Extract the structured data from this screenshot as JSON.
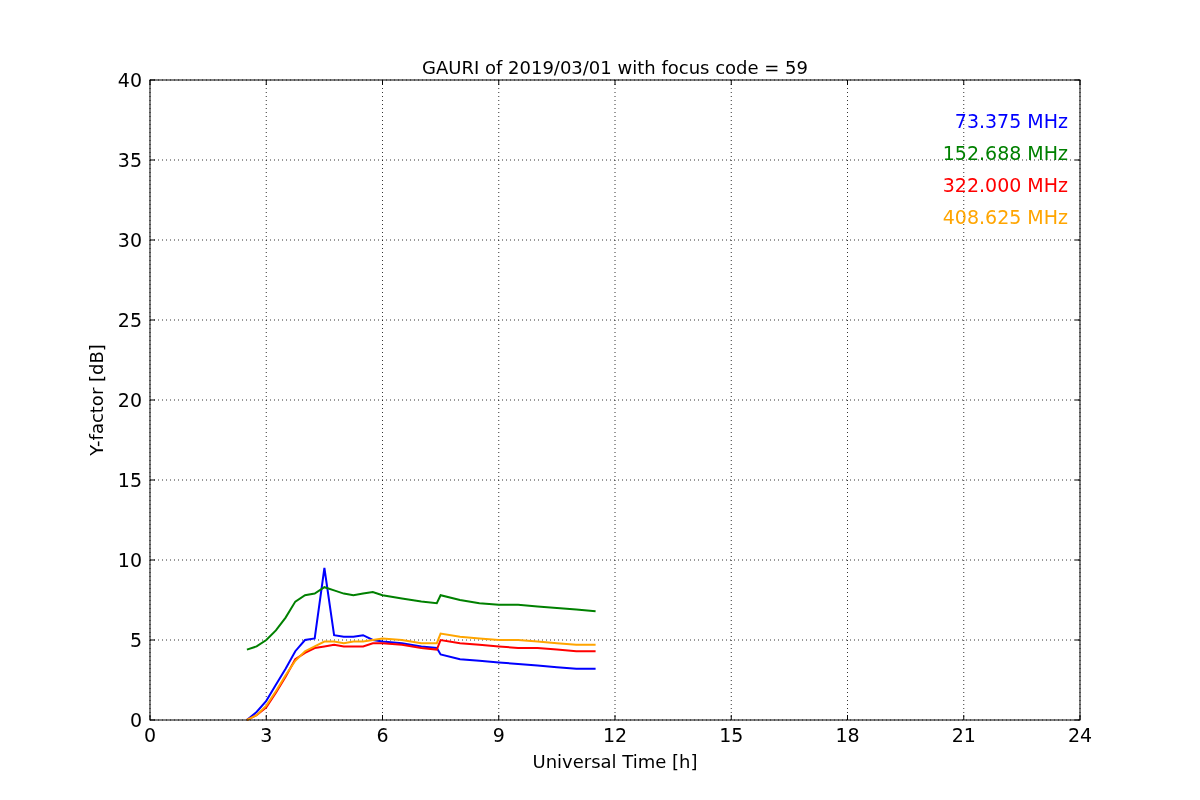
{
  "chart_data": {
    "type": "line",
    "title": "GAURI of 2019/03/01 with focus code = 59",
    "xlabel": "Universal Time [h]",
    "ylabel": "Y-factor [dB]",
    "x": [
      2.5,
      2.75,
      3,
      3.25,
      3.5,
      3.75,
      4,
      4.25,
      4.5,
      4.75,
      5,
      5.25,
      5.5,
      5.75,
      6,
      6.5,
      7,
      7.4,
      7.5,
      8,
      8.5,
      9,
      9.5,
      10,
      10.5,
      11,
      11.5
    ],
    "series": [
      {
        "name": "73.375 MHz",
        "color": "#0000ff",
        "values": [
          0,
          0.5,
          1.2,
          2.2,
          3.2,
          4.3,
          5.0,
          5.1,
          9.5,
          5.3,
          5.2,
          5.2,
          5.3,
          5.0,
          4.9,
          4.8,
          4.6,
          4.5,
          4.1,
          3.8,
          3.7,
          3.6,
          3.5,
          3.4,
          3.3,
          3.2,
          3.2
        ]
      },
      {
        "name": "152.688 MHz",
        "color": "#008000",
        "values": [
          4.4,
          4.6,
          5.0,
          5.6,
          6.4,
          7.4,
          7.8,
          7.9,
          8.3,
          8.1,
          7.9,
          7.8,
          7.9,
          8.0,
          7.8,
          7.6,
          7.4,
          7.3,
          7.8,
          7.5,
          7.3,
          7.2,
          7.2,
          7.1,
          7.0,
          6.9,
          6.8
        ]
      },
      {
        "name": "322.000 MHz",
        "color": "#ff0000",
        "values": [
          0,
          0.3,
          0.8,
          1.7,
          2.7,
          3.8,
          4.2,
          4.5,
          4.6,
          4.7,
          4.6,
          4.6,
          4.6,
          4.8,
          4.8,
          4.7,
          4.5,
          4.4,
          5.0,
          4.8,
          4.7,
          4.6,
          4.5,
          4.5,
          4.4,
          4.3,
          4.3
        ]
      },
      {
        "name": "408.625 MHz",
        "color": "#ffa500",
        "values": [
          0,
          0.3,
          0.9,
          1.8,
          2.8,
          3.7,
          4.3,
          4.6,
          4.9,
          4.9,
          4.8,
          4.9,
          4.9,
          5.0,
          5.1,
          5.0,
          4.8,
          4.8,
          5.4,
          5.2,
          5.1,
          5.0,
          5.0,
          4.9,
          4.8,
          4.7,
          4.7
        ]
      }
    ],
    "grid": true,
    "xlim": [
      0,
      24
    ],
    "ylim": [
      0,
      40
    ],
    "xticks": [
      0,
      3,
      6,
      9,
      12,
      15,
      18,
      21,
      24
    ],
    "yticks": [
      0,
      5,
      10,
      15,
      20,
      25,
      30,
      35,
      40
    ]
  }
}
